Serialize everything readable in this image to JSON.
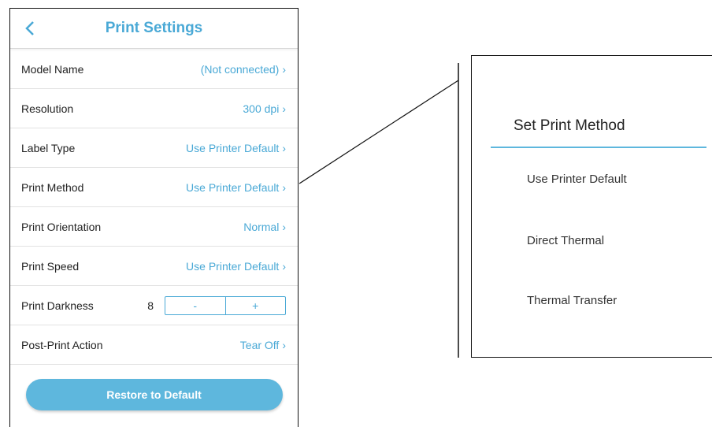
{
  "header": {
    "title": "Print Settings",
    "back_icon": "chevron-left-icon"
  },
  "rows": [
    {
      "label": "Model Name",
      "value": "(Not connected)"
    },
    {
      "label": "Resolution",
      "value": "300 dpi"
    },
    {
      "label": "Label Type",
      "value": "Use Printer Default"
    },
    {
      "label": "Print Method",
      "value": "Use Printer Default"
    },
    {
      "label": "Print Orientation",
      "value": "Normal"
    },
    {
      "label": "Print Speed",
      "value": "Use Printer Default"
    }
  ],
  "darkness": {
    "label": "Print Darkness",
    "value": "8",
    "minus": "-",
    "plus": "+"
  },
  "post_print": {
    "label": "Post-Print Action",
    "value": "Tear Off"
  },
  "chevron": "›",
  "restore_label": "Restore to Default",
  "popup": {
    "title": "Set Print Method",
    "options": [
      "Use Printer Default",
      "Direct Thermal",
      "Thermal Transfer"
    ]
  },
  "colors": {
    "accent": "#4aa9d6",
    "button": "#5eb7dd"
  }
}
